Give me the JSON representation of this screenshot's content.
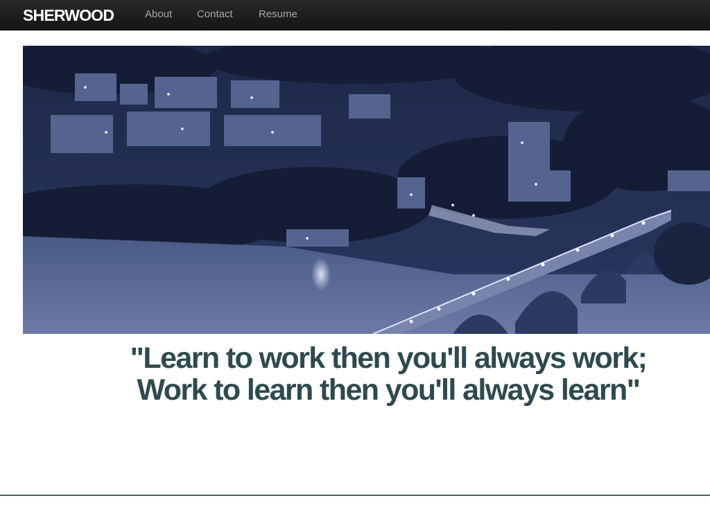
{
  "navbar": {
    "brand": "SHERWOOD",
    "links": [
      {
        "label": "About"
      },
      {
        "label": "Contact"
      },
      {
        "label": "Resume"
      }
    ]
  },
  "hero": {
    "image_description_icon": "city-bridge-night-photo"
  },
  "quote": {
    "line1": "\"Learn to work then you'll always work;",
    "line2": "Work to learn then you'll always learn\""
  },
  "colors": {
    "navbar_bg": "#1c1c1c",
    "brand_text": "#ffffff",
    "nav_link": "#a8a8a8",
    "quote_text": "#2e4a4e",
    "hero_tint": "#2b3a63",
    "divider": "#4a6266"
  }
}
